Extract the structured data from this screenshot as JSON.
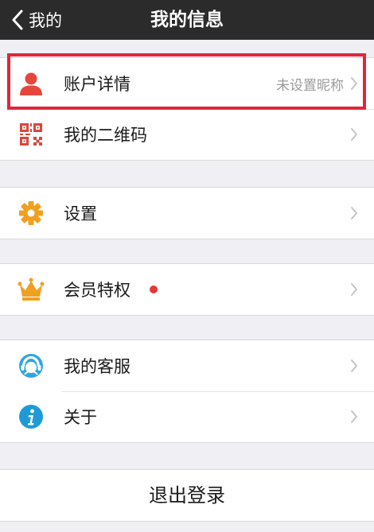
{
  "nav": {
    "back_label": "我的",
    "title": "我的信息"
  },
  "groups": [
    {
      "items": [
        {
          "label": "账户详情",
          "value": "未设置昵称",
          "icon": "person-icon"
        },
        {
          "label": "我的二维码",
          "icon": "qr-code-icon"
        }
      ]
    },
    {
      "items": [
        {
          "label": "设置",
          "icon": "gear-icon"
        }
      ]
    },
    {
      "items": [
        {
          "label": "会员特权",
          "icon": "crown-icon",
          "badge": "red-dot"
        }
      ]
    },
    {
      "items": [
        {
          "label": "我的客服",
          "icon": "customer-service-icon"
        },
        {
          "label": "关于",
          "icon": "info-icon"
        }
      ]
    }
  ],
  "logout": {
    "label": "退出登录"
  },
  "colors": {
    "navbar": "#2b2b2b",
    "highlight": "#e0263a",
    "person_icon": "#e5473c",
    "qr_icon": "#d9473c",
    "gear_icon": "#f0a020",
    "crown_icon": "#f0a020",
    "service_icon": "#2fa6de",
    "info_icon": "#1f9ad8",
    "badge": "#e53935"
  }
}
